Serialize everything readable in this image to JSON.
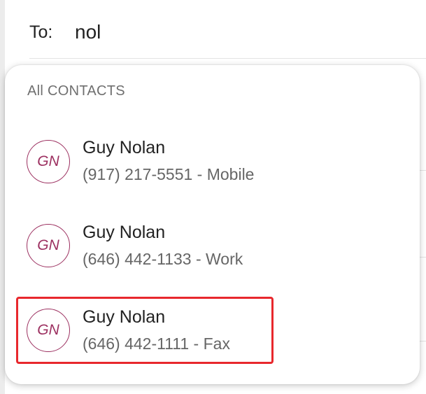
{
  "compose": {
    "to_label": "To:",
    "to_value": "nol"
  },
  "dropdown": {
    "section_header": "All CONTACTS",
    "contacts": [
      {
        "initials": "GN",
        "name": "Guy Nolan",
        "detail": "(917) 217-5551 - Mobile"
      },
      {
        "initials": "GN",
        "name": "Guy Nolan",
        "detail": "(646) 442-1133 - Work"
      },
      {
        "initials": "GN",
        "name": "Guy Nolan",
        "detail": "(646) 442-1111 - Fax"
      }
    ],
    "highlighted_index": 2
  },
  "colors": {
    "avatar_accent": "#9c3060",
    "highlight_border": "#e8282d"
  }
}
